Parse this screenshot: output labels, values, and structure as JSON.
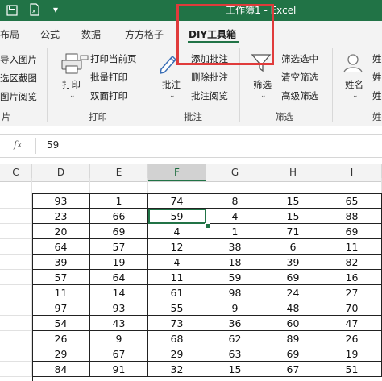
{
  "titlebar": {
    "quick_access_icons": [
      "save-icon",
      "undo-icon",
      "redo-icon",
      "excel-file-icon",
      "customize-qat-icon"
    ],
    "title_text": "工作簿1 - Excel"
  },
  "tabs": [
    {
      "label": "布局"
    },
    {
      "label": "公式"
    },
    {
      "label": "数据"
    },
    {
      "label": "方方格子"
    },
    {
      "label": "DIY工具箱",
      "active": true
    }
  ],
  "ribbon": {
    "left_partial_items": [
      "导入图片",
      "选区截图",
      "图片阅览"
    ],
    "left_partial_group": "片",
    "print": {
      "big_button": "打印",
      "items": [
        "打印当前页",
        "批量打印",
        "双面打印"
      ],
      "group": "打印"
    },
    "comment": {
      "big_button": "批注",
      "items": [
        "添加批注",
        "删除批注",
        "批注阅览"
      ],
      "group": "批注"
    },
    "filter": {
      "big_button": "筛选",
      "items": [
        "筛选选中",
        "清空筛选",
        "高级筛选"
      ],
      "group": "筛选"
    },
    "name": {
      "big_button": "姓名",
      "items": [
        "姓",
        "姓",
        "姓"
      ],
      "group": "姓"
    }
  },
  "formula_bar": {
    "fx": "fx",
    "value": "59"
  },
  "columns": [
    "C",
    "D",
    "E",
    "F",
    "G",
    "H",
    "I"
  ],
  "selected_column": "F",
  "rows": [
    [
      93,
      1,
      74,
      8,
      15,
      65
    ],
    [
      23,
      66,
      59,
      4,
      15,
      88
    ],
    [
      20,
      69,
      4,
      1,
      71,
      69
    ],
    [
      64,
      57,
      12,
      38,
      6,
      11
    ],
    [
      39,
      19,
      4,
      18,
      39,
      82
    ],
    [
      57,
      64,
      11,
      59,
      69,
      16
    ],
    [
      11,
      14,
      61,
      98,
      24,
      27
    ],
    [
      97,
      93,
      55,
      9,
      48,
      70
    ],
    [
      54,
      43,
      73,
      36,
      60,
      47
    ],
    [
      26,
      9,
      68,
      62,
      89,
      26
    ],
    [
      29,
      67,
      29,
      63,
      69,
      19
    ],
    [
      84,
      91,
      32,
      15,
      67,
      51
    ]
  ],
  "colors": {
    "excel_green": "#217346",
    "highlight_red": "#e03b3b"
  }
}
